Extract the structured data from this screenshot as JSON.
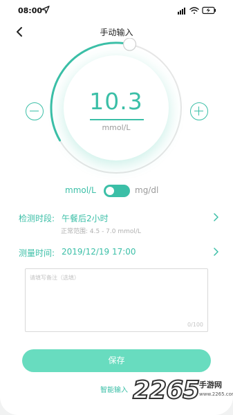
{
  "status_bar": {
    "time": "08:00",
    "icons": [
      "location-arrow-icon",
      "signal-icon",
      "wifi-icon",
      "battery-icon"
    ]
  },
  "header": {
    "title": "手动输入",
    "back_icon": "chevron-left-icon"
  },
  "gauge": {
    "value": "10.3",
    "unit": "mmol/L",
    "level": 0.55,
    "minus_icon": "minus-circle-icon",
    "plus_icon": "plus-circle-icon"
  },
  "unit_toggle": {
    "left_label": "mmol/L",
    "right_label": "mg/dl",
    "selected": "mmol/L"
  },
  "measure_period": {
    "label": "检测时段:",
    "value": "午餐后2小时",
    "normal_range": "正常范围: 4.5 - 7.0 mmol/L"
  },
  "measure_time": {
    "label": "测量时间:",
    "value": "2019/12/19  17:00"
  },
  "note": {
    "placeholder": "请填写备注（选填）",
    "value": "",
    "counter": "0/100"
  },
  "actions": {
    "save_label": "保存",
    "smart_input_label": "智能输入"
  },
  "watermark": {
    "number": "2265",
    "text": "手游网",
    "url": "www.2265.com"
  },
  "colors": {
    "accent": "#3bbfa7",
    "button": "#68dcbf"
  }
}
